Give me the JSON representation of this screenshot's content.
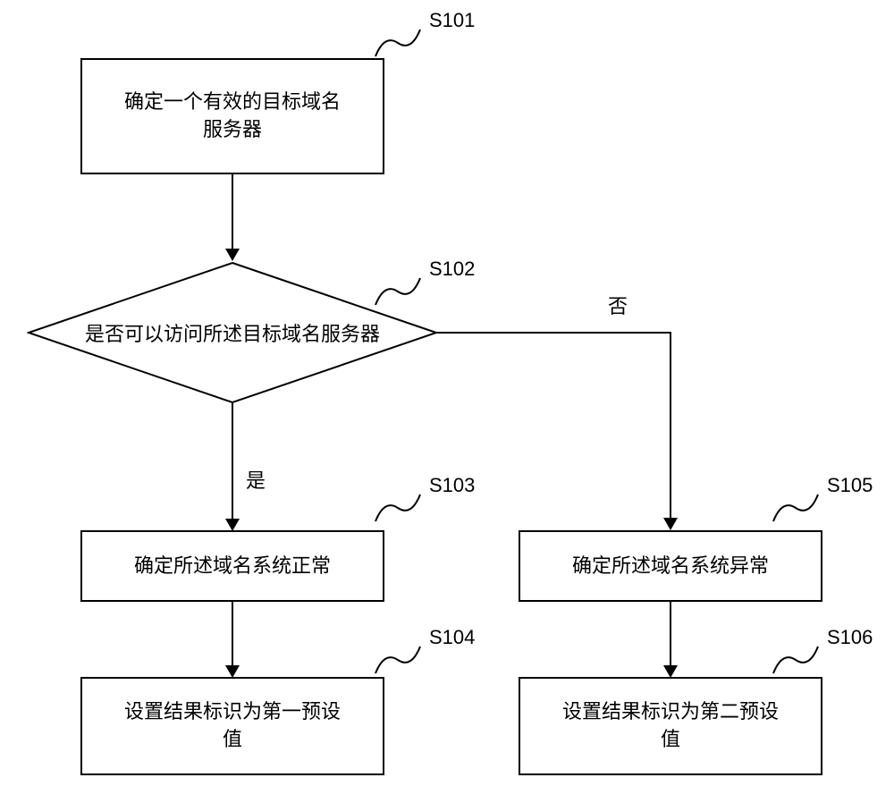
{
  "steps": {
    "s101": {
      "label": "S101",
      "text": "确定一个有效的目标域名\n服务器"
    },
    "s102": {
      "label": "S102",
      "text": "是否可以访问所述目标域名服务器"
    },
    "s103": {
      "label": "S103",
      "text": "确定所述域名系统正常"
    },
    "s104": {
      "label": "S104",
      "text": "设置结果标识为第一预设\n值"
    },
    "s105": {
      "label": "S105",
      "text": "确定所述域名系统异常"
    },
    "s106": {
      "label": "S106",
      "text": "设置结果标识为第二预设\n值"
    }
  },
  "edges": {
    "yes": "是",
    "no": "否"
  }
}
